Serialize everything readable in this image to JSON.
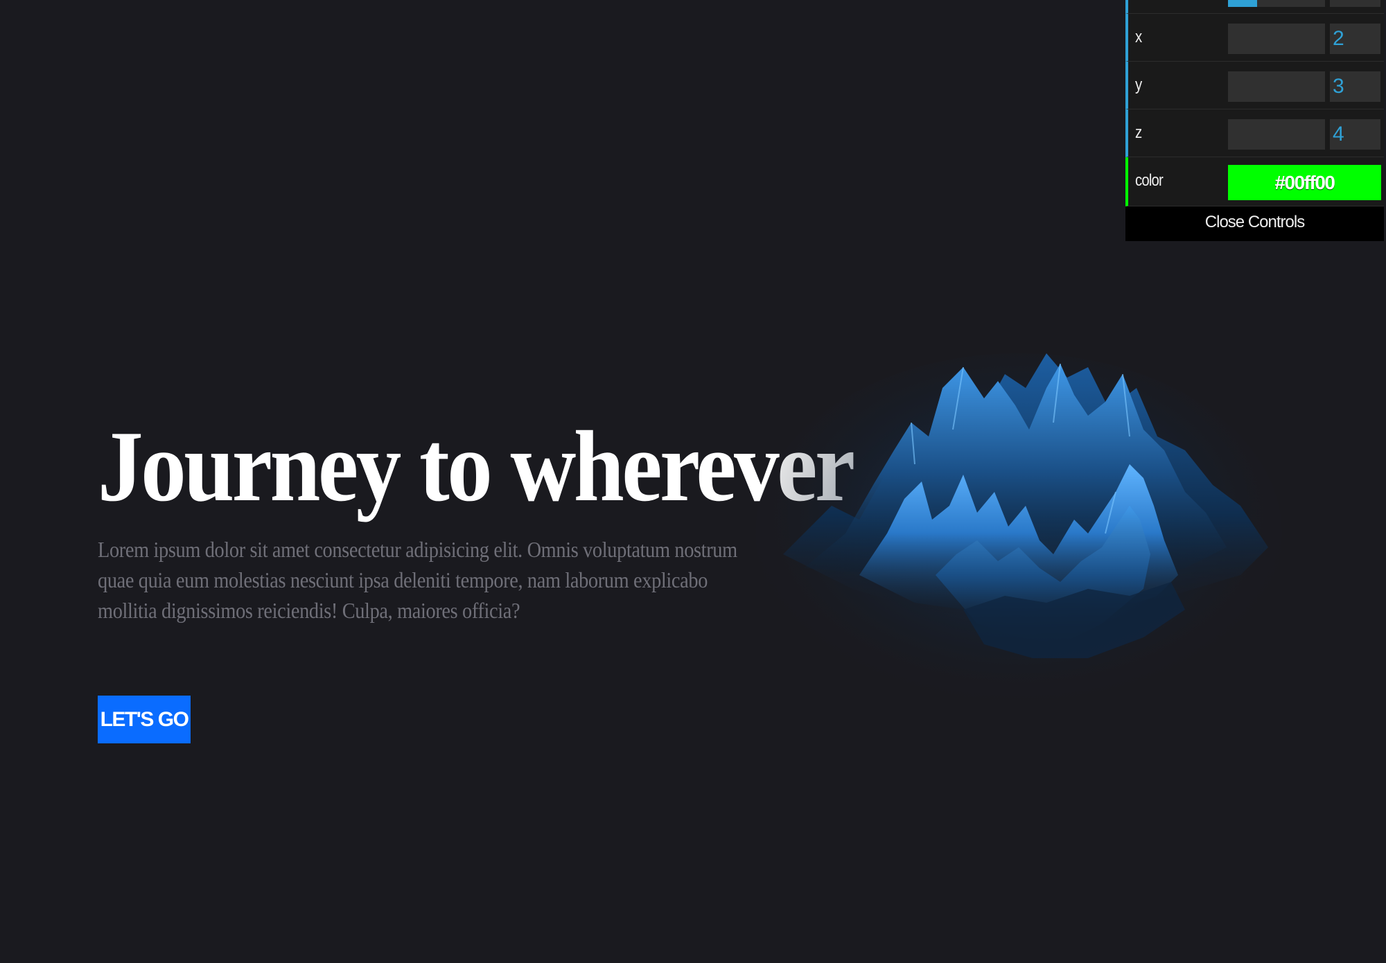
{
  "hero": {
    "title": "Journey to wherever",
    "description": "Lorem ipsum dolor sit amet consectetur adipisicing elit. Omnis voluptatum nostrum quae quia eum molestias nesciunt ipsa deleniti tempore, nam laborum explicabo mollitia dignissimos reiciendis! Culpa, maiores officia?",
    "cta_label": "LET'S GO"
  },
  "controls": {
    "top_slider_fraction": 0.3,
    "rows": [
      {
        "label": "x",
        "value": "2"
      },
      {
        "label": "y",
        "value": "3"
      },
      {
        "label": "z",
        "value": "4"
      }
    ],
    "color": {
      "label": "color",
      "value": "#00ff00"
    },
    "close_label": "Close Controls"
  },
  "colors": {
    "background": "#1a1a1f",
    "accent": "#0a6cff",
    "gui_number": "#2fa1d6",
    "mesh": "#2a79c9"
  }
}
